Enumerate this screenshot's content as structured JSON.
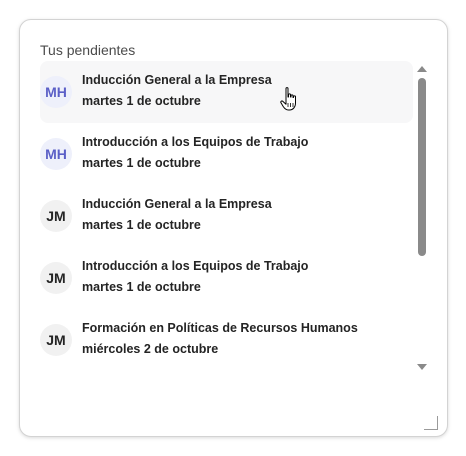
{
  "panel": {
    "title": "Tus pendientes",
    "items": [
      {
        "initials": "MH",
        "name": "Inducción General a la Empresa",
        "date_prefix": "martes",
        "date_day": "1",
        "date_suffix": "de octubre"
      },
      {
        "initials": "MH",
        "name": "Introducción a los Equipos de Trabajo",
        "date_prefix": "martes",
        "date_day": "1",
        "date_suffix": "de octubre"
      },
      {
        "initials": "JM",
        "name": "Inducción General a la Empresa",
        "date_prefix": "martes",
        "date_day": "1",
        "date_suffix": "de octubre"
      },
      {
        "initials": "JM",
        "name": "Introducción a los Equipos de Trabajo",
        "date_prefix": "martes",
        "date_day": "1",
        "date_suffix": "de octubre"
      },
      {
        "initials": "JM",
        "name": "Formación en Políticas de Recursos Humanos",
        "date_prefix": "miércoles",
        "date_day": "2",
        "date_suffix": "de octubre"
      }
    ]
  },
  "colors": {
    "avatar_mh_text": "#5b5fc7",
    "avatar_mh_bg": "#eef0fb",
    "avatar_jm_text": "#242424",
    "avatar_jm_bg": "#f1f1f1"
  },
  "icons": {
    "cursor": "hand-pointer-icon",
    "scroll_up": "triangle-up-icon",
    "scroll_down": "triangle-down-icon",
    "resize": "resize-handle-icon"
  }
}
